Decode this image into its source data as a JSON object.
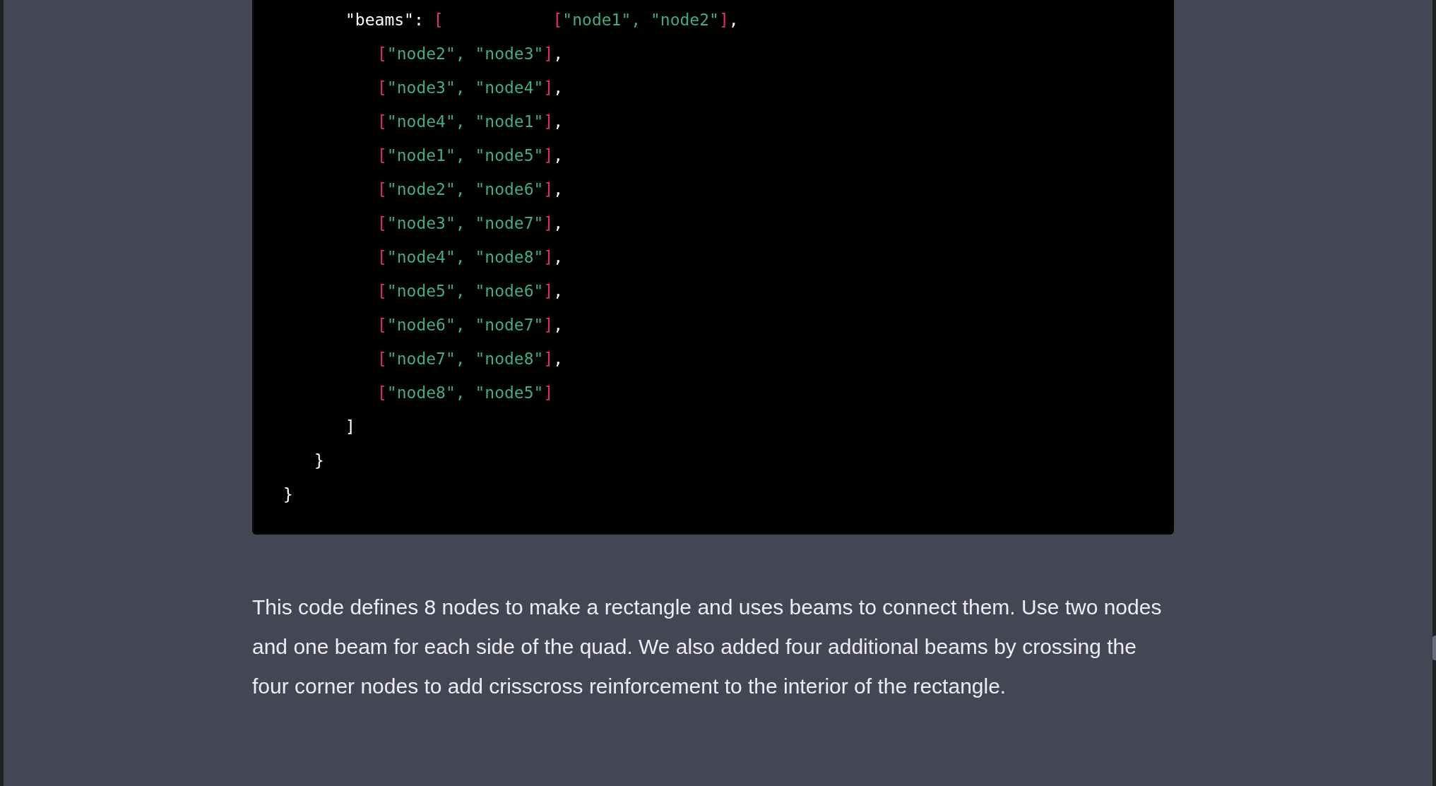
{
  "code_block": {
    "lines": [
      {
        "kind": "key",
        "tokens": [
          {
            "kind": "text",
            "text": "\"beams\""
          },
          {
            "kind": "punct",
            "text": ": "
          },
          {
            "kind": "bracket",
            "text": "["
          },
          {
            "kind": "bracket_far",
            "text": "["
          },
          {
            "kind": "string",
            "text": "\"node1\", \"node2\""
          },
          {
            "kind": "bracket",
            "text": "]"
          },
          {
            "kind": "text",
            "text": ","
          }
        ]
      },
      {
        "kind": "item",
        "tokens": [
          {
            "kind": "bracket",
            "text": "["
          },
          {
            "kind": "string",
            "text": "\"node2\", \"node3\""
          },
          {
            "kind": "bracket",
            "text": "]"
          },
          {
            "kind": "text",
            "text": ","
          }
        ]
      },
      {
        "kind": "item",
        "tokens": [
          {
            "kind": "bracket",
            "text": "["
          },
          {
            "kind": "string",
            "text": "\"node3\", \"node4\""
          },
          {
            "kind": "bracket",
            "text": "]"
          },
          {
            "kind": "text",
            "text": ","
          }
        ]
      },
      {
        "kind": "item",
        "tokens": [
          {
            "kind": "bracket",
            "text": "["
          },
          {
            "kind": "string",
            "text": "\"node4\", \"node1\""
          },
          {
            "kind": "bracket",
            "text": "]"
          },
          {
            "kind": "text",
            "text": ","
          }
        ]
      },
      {
        "kind": "item",
        "tokens": [
          {
            "kind": "bracket",
            "text": "["
          },
          {
            "kind": "string",
            "text": "\"node1\", \"node5\""
          },
          {
            "kind": "bracket",
            "text": "]"
          },
          {
            "kind": "text",
            "text": ","
          }
        ]
      },
      {
        "kind": "item",
        "tokens": [
          {
            "kind": "bracket",
            "text": "["
          },
          {
            "kind": "string",
            "text": "\"node2\", \"node6\""
          },
          {
            "kind": "bracket",
            "text": "]"
          },
          {
            "kind": "text",
            "text": ","
          }
        ]
      },
      {
        "kind": "item",
        "tokens": [
          {
            "kind": "bracket",
            "text": "["
          },
          {
            "kind": "string",
            "text": "\"node3\", \"node7\""
          },
          {
            "kind": "bracket",
            "text": "]"
          },
          {
            "kind": "text",
            "text": ","
          }
        ]
      },
      {
        "kind": "item",
        "tokens": [
          {
            "kind": "bracket",
            "text": "["
          },
          {
            "kind": "string",
            "text": "\"node4\", \"node8\""
          },
          {
            "kind": "bracket",
            "text": "]"
          },
          {
            "kind": "text",
            "text": ","
          }
        ]
      },
      {
        "kind": "item",
        "tokens": [
          {
            "kind": "bracket",
            "text": "["
          },
          {
            "kind": "string",
            "text": "\"node5\", \"node6\""
          },
          {
            "kind": "bracket",
            "text": "]"
          },
          {
            "kind": "text",
            "text": ","
          }
        ]
      },
      {
        "kind": "item",
        "tokens": [
          {
            "kind": "bracket",
            "text": "["
          },
          {
            "kind": "string",
            "text": "\"node6\", \"node7\""
          },
          {
            "kind": "bracket",
            "text": "]"
          },
          {
            "kind": "text",
            "text": ","
          }
        ]
      },
      {
        "kind": "item",
        "tokens": [
          {
            "kind": "bracket",
            "text": "["
          },
          {
            "kind": "string",
            "text": "\"node7\", \"node8\""
          },
          {
            "kind": "bracket",
            "text": "]"
          },
          {
            "kind": "text",
            "text": ","
          }
        ]
      },
      {
        "kind": "item",
        "tokens": [
          {
            "kind": "bracket",
            "text": "["
          },
          {
            "kind": "string",
            "text": "\"node8\", \"node5\""
          },
          {
            "kind": "bracket",
            "text": "]"
          }
        ]
      },
      {
        "kind": "close2",
        "tokens": [
          {
            "kind": "text",
            "text": "]"
          }
        ]
      },
      {
        "kind": "close1",
        "tokens": [
          {
            "kind": "text",
            "text": "}"
          }
        ]
      },
      {
        "kind": "close0",
        "tokens": [
          {
            "kind": "text",
            "text": "}"
          }
        ]
      }
    ]
  },
  "paragraph": "This code defines 8 nodes to make a rectangle and uses beams to connect them. Use two nodes and one beam for each side of the quad. We also added four additional beams by crossing the four corner nodes to add crisscross reinforcement to the interior of the rectangle."
}
